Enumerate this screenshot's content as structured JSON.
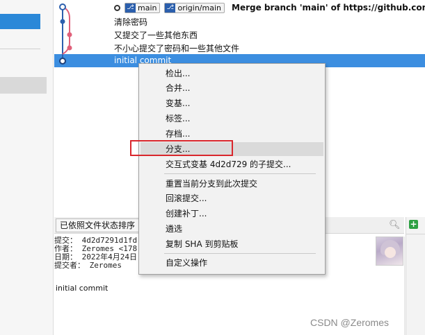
{
  "commits": [
    {
      "message": "Merge branch 'main' of https://github.com",
      "tags": [
        "main",
        "origin/main"
      ]
    },
    {
      "message": "清除密码"
    },
    {
      "message": "又提交了一些其他东西"
    },
    {
      "message": "不小心提交了密码和一些其他文件"
    },
    {
      "message": "initial commit",
      "selected": true
    }
  ],
  "context_menu": {
    "items": [
      {
        "label": "检出..."
      },
      {
        "label": "合并..."
      },
      {
        "label": "变基..."
      },
      {
        "label": "标签..."
      },
      {
        "label": "存档..."
      },
      {
        "label": "分支...",
        "highlighted": true
      },
      {
        "label": "交互式变基 4d2d729 的子提交..."
      },
      {
        "label": "重置当前分支到此次提交"
      },
      {
        "label": "回滚提交..."
      },
      {
        "label": "创建补丁..."
      },
      {
        "label": "遴选"
      },
      {
        "label": "复制 SHA 到剪贴板"
      },
      {
        "label": "自定义操作"
      }
    ]
  },
  "lower_panel": {
    "sort_label": "已依照文件状态排序",
    "details": [
      "提交： 4d2d7291d1fd",
      "作者： Zeromes <178",
      "日期： 2022年4月24日",
      "提交者： Zeromes"
    ],
    "commit_message": "initial commit"
  },
  "watermark": "CSDN @Zeromes",
  "icons": [
    "branch-icon",
    "search-icon",
    "plus-icon",
    "head-ring-icon"
  ]
}
